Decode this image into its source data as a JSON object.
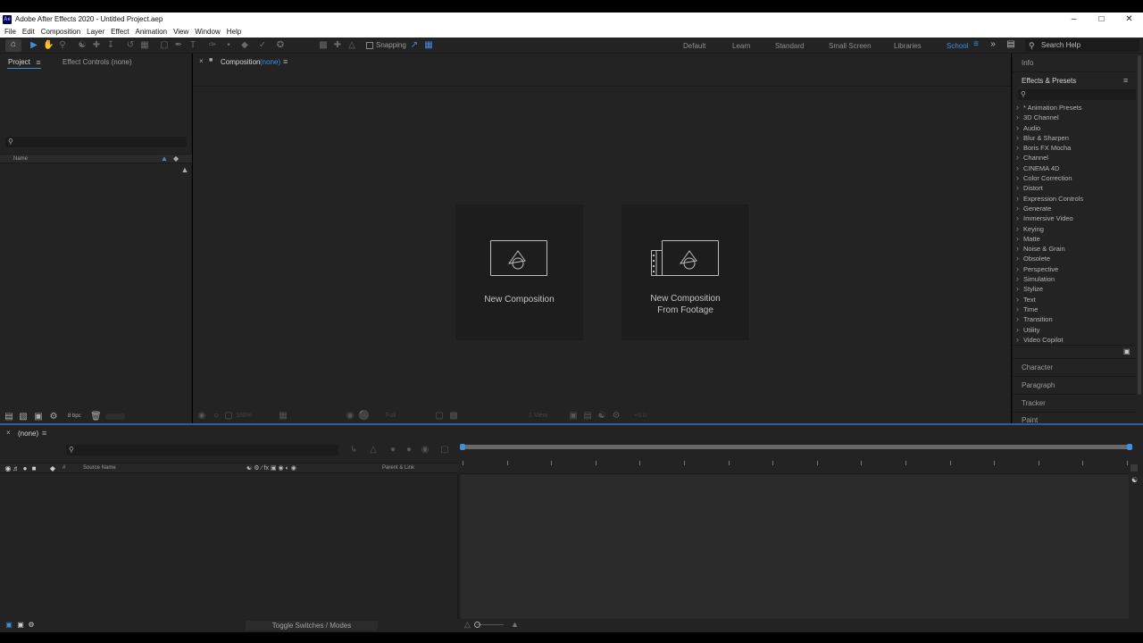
{
  "window": {
    "app_icon": "Ae",
    "title": "Adobe After Effects 2020 - Untitled Project.aep",
    "controls": [
      "minimize-icon",
      "maximize-icon",
      "close-icon"
    ]
  },
  "menu": [
    "File",
    "Edit",
    "Composition",
    "Layer",
    "Effect",
    "Animation",
    "View",
    "Window",
    "Help"
  ],
  "toolbar": {
    "snapping_label": "Snapping",
    "workspaces": [
      "Default",
      "Learn",
      "Standard",
      "Small Screen",
      "Libraries",
      "School"
    ],
    "active_workspace": "School",
    "search_help": "Search Help",
    "accent_color": "#3d8fe0"
  },
  "project_panel": {
    "tabs": [
      "Project",
      "Effect Controls (none)"
    ],
    "name_column": "Name",
    "bpc": "8 bpc"
  },
  "composition_panel": {
    "tab_label": "Composition",
    "tab_value": "(none)",
    "new_comp": "New Composition",
    "new_comp_footage_line1": "New Composition",
    "new_comp_footage_line2": "From Footage",
    "footer": {
      "zoom": "100%",
      "quality": "Full",
      "views": "1 View",
      "exposure": "+0.0"
    }
  },
  "right_panel": {
    "info": "Info",
    "effects_title": "Effects & Presets",
    "effects": [
      "* Animation Presets",
      "3D Channel",
      "Audio",
      "Blur & Sharpen",
      "Boris FX Mocha",
      "Channel",
      "CINEMA 4D",
      "Color Correction",
      "Distort",
      "Expression Controls",
      "Generate",
      "Immersive Video",
      "Keying",
      "Matte",
      "Noise & Grain",
      "Obsolete",
      "Perspective",
      "Simulation",
      "Stylize",
      "Text",
      "Time",
      "Transition",
      "Utility",
      "Video Copilot"
    ],
    "character": "Character",
    "paragraph": "Paragraph",
    "tracker": "Tracker",
    "paint": "Paint"
  },
  "timeline": {
    "tab": "(none)",
    "source_name": "Source Name",
    "parent_link": "Parent & Link",
    "hash": "#",
    "toggle": "Toggle Switches / Modes"
  }
}
